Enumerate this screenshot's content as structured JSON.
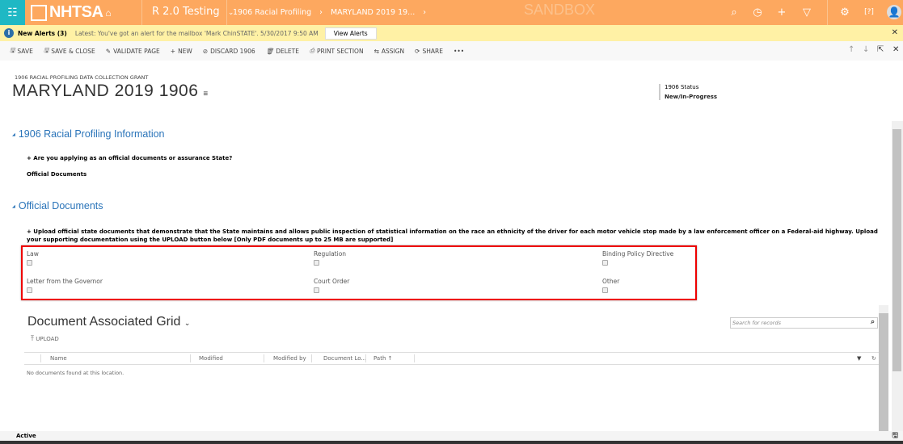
{
  "header": {
    "brand": "NHTSA",
    "environment": "R 2.0 Testing",
    "breadcrumb": [
      "1906 Racial Profiling",
      "MARYLAND 2019 19..."
    ],
    "watermark": "SANDBOX",
    "icons": [
      "search-icon",
      "history-icon",
      "plus-icon",
      "filter-icon",
      "gear-icon",
      "help-icon",
      "user-icon"
    ],
    "color": "#fda85f",
    "waffle_color": "#1fb8c4"
  },
  "alert": {
    "title": "New Alerts (3)",
    "message": "Latest: You've got an alert for the mailbox 'Mark ChinSTATE'. 5/30/2017 9:50 AM",
    "button": "View Alerts"
  },
  "commands": [
    {
      "label": "SAVE",
      "icon": "🖫"
    },
    {
      "label": "SAVE & CLOSE",
      "icon": "🖫"
    },
    {
      "label": "VALIDATE PAGE",
      "icon": "✎"
    },
    {
      "label": "NEW",
      "icon": "+"
    },
    {
      "label": "DISCARD 1906",
      "icon": "⊘"
    },
    {
      "label": "DELETE",
      "icon": "🗑"
    },
    {
      "label": "PRINT SECTION",
      "icon": "⎙"
    },
    {
      "label": "ASSIGN",
      "icon": "⇆"
    },
    {
      "label": "SHARE",
      "icon": "⟳"
    },
    {
      "label": "•••",
      "icon": ""
    }
  ],
  "record": {
    "entity": "1906 RACIAL PROFILING DATA COLLECTION GRANT",
    "title": "MARYLAND 2019 1906",
    "status_label": "1906 Status",
    "status_value": "New/In-Progress"
  },
  "section1": {
    "title": "1906 Racial Profiling Information",
    "question": "+ Are you applying as an official documents or assurance State?",
    "answer": "Official Documents"
  },
  "section2": {
    "title": "Official Documents",
    "instruction": "+ Upload official state documents that demonstrate that the State maintains and allows public inspection of statistical information on the race an ethnicity of the driver for each motor vehicle stop made by a law enforcement officer on a Federal-aid highway. Upload your supporting documentation using the UPLOAD button below [Only PDF documents up to 25 MB are supported]",
    "checkboxes": [
      {
        "label": "Law",
        "checked": false
      },
      {
        "label": "Regulation",
        "checked": false
      },
      {
        "label": "Binding Policy Directive",
        "checked": false
      },
      {
        "label": "Letter from the Governor",
        "checked": false
      },
      {
        "label": "Court Order",
        "checked": false
      },
      {
        "label": "Other",
        "checked": false
      }
    ]
  },
  "grid": {
    "title": "Document Associated Grid",
    "upload": "UPLOAD",
    "search_placeholder": "Search for records",
    "columns": [
      "Name",
      "Modified",
      "Modified by",
      "Document Lo...",
      "Path ↑"
    ],
    "empty": "No documents found at this location."
  },
  "footer": {
    "status": "Active"
  }
}
